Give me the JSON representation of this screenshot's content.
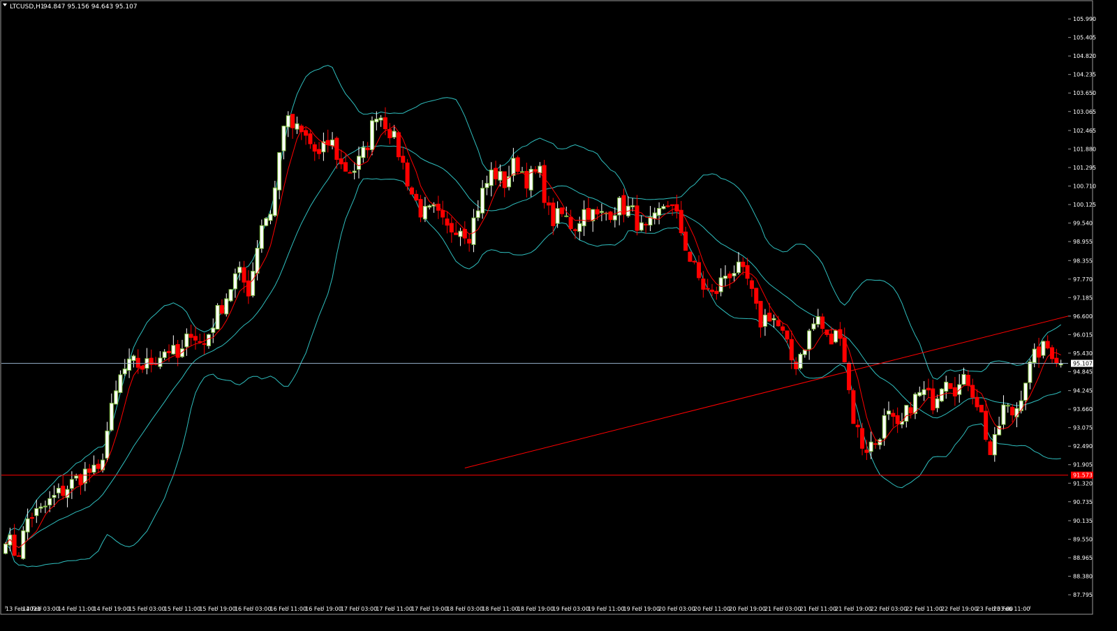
{
  "header": {
    "symbol_label": "LTCUSD,H1",
    "ohlc_label": "94.847 95.156 94.643 95.107"
  },
  "colors": {
    "background": "#000000",
    "bull_candle": "#7fbf3f",
    "bull_body_fill": "#ffffff",
    "bear_candle": "#ff0000",
    "bollinger": "#2fbfbf",
    "moving_average": "#ff0000",
    "trendline": "#ff0000",
    "current_price_line": "#8fa8c0",
    "support_line": "#ff0000",
    "axis_text": "#ffffff"
  },
  "icons": {
    "menu": "triangle-down-icon"
  },
  "chart_data": {
    "type": "candlestick",
    "symbol": "LTCUSD",
    "timeframe": "H1",
    "y_ticks": [
      "105.990",
      "105.405",
      "104.820",
      "104.235",
      "103.650",
      "103.065",
      "102.465",
      "101.880",
      "101.295",
      "100.710",
      "100.125",
      "99.540",
      "98.955",
      "98.355",
      "97.770",
      "97.185",
      "96.600",
      "96.015",
      "95.430",
      "94.845",
      "94.245",
      "93.660",
      "93.075",
      "92.490",
      "91.905",
      "91.320",
      "90.735",
      "90.135",
      "89.550",
      "88.965",
      "88.380",
      "87.795"
    ],
    "ylim": [
      87.62,
      106.28
    ],
    "x_ticks": [
      "13 Feb 2023",
      "14 Feb 03:00",
      "14 Feb 11:00",
      "14 Feb 19:00",
      "15 Feb 03:00",
      "15 Feb 11:00",
      "15 Feb 19:00",
      "16 Feb 03:00",
      "16 Feb 11:00",
      "16 Feb 19:00",
      "17 Feb 03:00",
      "17 Feb 11:00",
      "17 Feb 19:00",
      "18 Feb 03:00",
      "18 Feb 11:00",
      "18 Feb 19:00",
      "19 Feb 03:00",
      "19 Feb 11:00",
      "19 Feb 19:00",
      "20 Feb 03:00",
      "20 Feb 11:00",
      "20 Feb 19:00",
      "21 Feb 03:00",
      "21 Feb 11:00",
      "21 Feb 19:00",
      "22 Feb 03:00",
      "22 Feb 11:00",
      "22 Feb 19:00",
      "23 Feb 03:00",
      "23 Feb 11:00"
    ],
    "price_path": [
      89.7,
      89.0,
      90.3,
      90.4,
      90.8,
      91.1,
      91.4,
      91.7,
      91.6,
      93.4,
      94.8,
      95.1,
      95.0,
      95.3,
      95.6,
      95.2,
      96.2,
      95.6,
      96.5,
      97.2,
      98.0,
      97.4,
      99.5,
      100.0,
      102.8,
      102.5,
      102.2,
      101.6,
      102.2,
      101.3,
      101.2,
      101.8,
      103.1,
      102.6,
      101.7,
      100.5,
      99.8,
      99.9,
      99.3,
      99.5,
      99.2,
      100.4,
      101.2,
      100.8,
      101.5,
      100.9,
      101.2,
      99.6,
      99.8,
      99.4,
      100.0,
      99.7,
      99.9,
      100.1,
      99.9,
      99.2,
      99.6,
      100.3,
      99.6,
      98.4,
      97.6,
      97.2,
      97.9,
      98.1,
      97.7,
      96.4,
      96.7,
      96.0,
      95.0,
      95.8,
      96.6,
      95.7,
      96.2,
      93.5,
      92.4,
      92.6,
      93.5,
      92.9,
      93.8,
      94.2,
      93.9,
      94.8,
      94.3,
      94.6,
      93.7,
      92.1,
      93.7,
      93.5,
      94.7,
      95.5,
      95.6,
      95.1
    ],
    "current_price": 95.107,
    "current_price_label": "95.107",
    "support_price": 91.575,
    "support_label": "91.573",
    "trendline": {
      "start": {
        "time": "18 Feb 03:00",
        "price": 91.8
      },
      "end": {
        "time": "23 Feb 11:00",
        "price": 96.6
      }
    },
    "indicators": [
      "Bollinger Bands",
      "Moving Average"
    ]
  }
}
